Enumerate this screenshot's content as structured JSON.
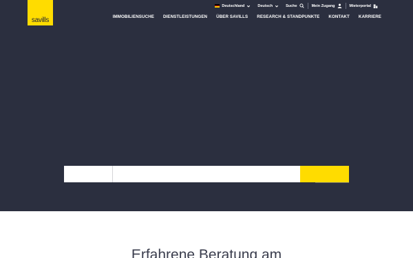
{
  "brand": {
    "logo_text": "savills",
    "accent": "#ffdc00",
    "hero_bg": "#2b2f3f"
  },
  "utility_nav": {
    "country": "Deutschland",
    "language": "Deutsch",
    "search": "Suche",
    "account": "Mein Zugang",
    "tenant_portal": "Mieterportal"
  },
  "main_nav": {
    "items": [
      {
        "label": "IMMOBILIENSUCHE"
      },
      {
        "label": "DIENSTLEISTUNGEN"
      },
      {
        "label": "ÜBER SAVILLS"
      },
      {
        "label": "RESEARCH & STANDPUNKTE"
      },
      {
        "label": "KONTAKT"
      },
      {
        "label": "KARRIERE"
      }
    ]
  },
  "search_bar": {
    "select_value": "",
    "input_value": "",
    "button_label": ""
  },
  "section": {
    "heading": "Erfahrene Beratung am"
  },
  "icons": [
    "germany-flag-icon",
    "chevron-down-icon",
    "search-icon",
    "user-icon",
    "building-icon"
  ]
}
